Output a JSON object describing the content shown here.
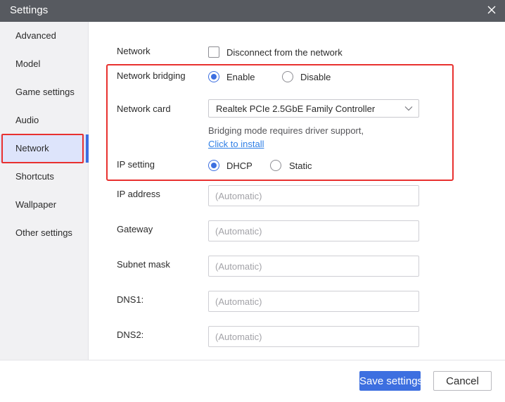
{
  "window": {
    "title": "Settings",
    "close_icon": "close-icon"
  },
  "sidebar": {
    "items": [
      {
        "label": "Advanced",
        "active": false
      },
      {
        "label": "Model",
        "active": false
      },
      {
        "label": "Game settings",
        "active": false
      },
      {
        "label": "Audio",
        "active": false
      },
      {
        "label": "Network",
        "active": true
      },
      {
        "label": "Shortcuts",
        "active": false
      },
      {
        "label": "Wallpaper",
        "active": false
      },
      {
        "label": "Other settings",
        "active": false
      }
    ]
  },
  "network": {
    "label": "Network",
    "disconnect_label": "Disconnect from the network",
    "disconnect_checked": false,
    "bridging": {
      "label": "Network bridging",
      "enable_label": "Enable",
      "disable_label": "Disable",
      "selected": "Enable"
    },
    "card": {
      "label": "Network card",
      "value": "Realtek PCIe 2.5GbE Family Controller"
    },
    "bridging_note": "Bridging mode requires driver support,",
    "install_link": "Click to install",
    "ip_setting": {
      "label": "IP setting",
      "dhcp_label": "DHCP",
      "static_label": "Static",
      "selected": "DHCP"
    },
    "ip_address": {
      "label": "IP address",
      "placeholder": "(Automatic)"
    },
    "gateway": {
      "label": "Gateway",
      "placeholder": "(Automatic)"
    },
    "subnet_mask": {
      "label": "Subnet mask",
      "placeholder": "(Automatic)"
    },
    "dns1": {
      "label": "DNS1:",
      "placeholder": "(Automatic)"
    },
    "dns2": {
      "label": "DNS2:",
      "placeholder": "(Automatic)"
    }
  },
  "footer": {
    "save_label": "Save settings",
    "cancel_label": "Cancel"
  },
  "colors": {
    "accent": "#3d6fe0",
    "highlight": "#e8312f",
    "titlebar": "#575a60",
    "link": "#2f7fe6"
  }
}
